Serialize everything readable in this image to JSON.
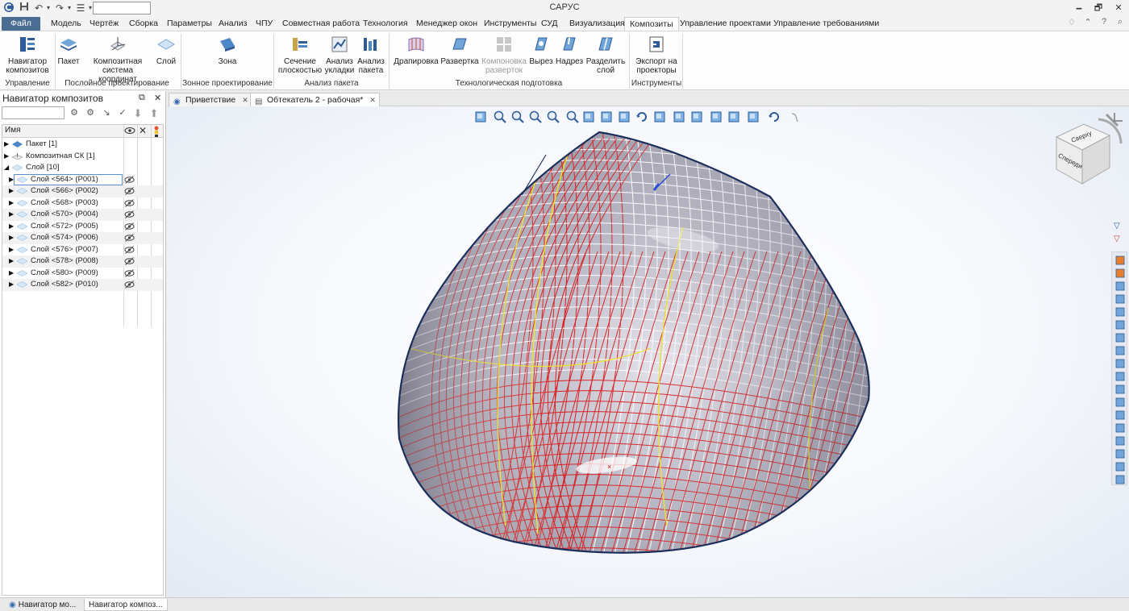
{
  "window": {
    "title": "САРУС"
  },
  "menu": {
    "file": "Файл",
    "tabs": [
      "Модель",
      "Чертёж",
      "Сборка",
      "Параметры",
      "Анализ",
      "ЧПУ",
      "Совместная работа",
      "Технология",
      "Менеджер окон",
      "Инструменты",
      "СУД",
      "Визуализация",
      "Композиты",
      "Управление проектами",
      "Управление требованиями"
    ],
    "active_tab": "Композиты"
  },
  "ribbon": {
    "nav_composites": "Навигатор композитов",
    "group_control": "Управление",
    "package": "Пакет",
    "composite_cs": "Композитная система координат",
    "layer": "Слой",
    "group_layer_design": "Послойное проектирование",
    "zone": "Зона",
    "group_zone_design": "Зонное проектирование",
    "plane_section": "Сечение плоскостью",
    "layup_analysis": "Анализ укладки",
    "package_analysis": "Анализ пакета",
    "group_package_analysis": "Анализ пакета",
    "draping": "Драпировка",
    "flattening": "Развертка",
    "flat_layout": "Компоновка разверток",
    "cutout": "Вырез",
    "notch": "Надрез",
    "split_layer": "Разделить слой",
    "group_tech_prep": "Технологическая подготовка",
    "export_projectors": "Экспорт на проекторы",
    "group_tools": "Инструменты"
  },
  "panel": {
    "title": "Навигатор композитов",
    "column_name": "Имя",
    "tree": [
      {
        "label": "Пакет [1]",
        "level": 0,
        "expanded": false,
        "icon": "package-icon"
      },
      {
        "label": "Композитная СК [1]",
        "level": 0,
        "expanded": false,
        "icon": "composite-cs-icon"
      },
      {
        "label": "Слой [10]",
        "level": 0,
        "expanded": true,
        "icon": "layer-icon"
      },
      {
        "label": "Слой <564> (P001)",
        "level": 1,
        "selected": true
      },
      {
        "label": "Слой <566> (P002)",
        "level": 1
      },
      {
        "label": "Слой <568> (P003)",
        "level": 1
      },
      {
        "label": "Слой <570> (P004)",
        "level": 1
      },
      {
        "label": "Слой <572> (P005)",
        "level": 1
      },
      {
        "label": "Слой <574> (P006)",
        "level": 1
      },
      {
        "label": "Слой <576> (P007)",
        "level": 1
      },
      {
        "label": "Слой <578> (P008)",
        "level": 1
      },
      {
        "label": "Слой <580> (P009)",
        "level": 1
      },
      {
        "label": "Слой <582> (P010)",
        "level": 1
      }
    ]
  },
  "doc_tabs": [
    {
      "label": "Приветствие",
      "active": false
    },
    {
      "label": "Обтекатель 2 - рабочая*",
      "active": true
    }
  ],
  "bottom_tabs": [
    "Навигатор мо...",
    "Навигатор композ..."
  ],
  "viewcube": {
    "top": "Сверху",
    "front": "Спереди"
  },
  "colors": {
    "accent": "#4b6c93",
    "mesh_red": "#d81e1e",
    "mesh_yellow": "#f2e21b",
    "surface": "#a9a8b6",
    "edge": "#1c2f5c"
  }
}
